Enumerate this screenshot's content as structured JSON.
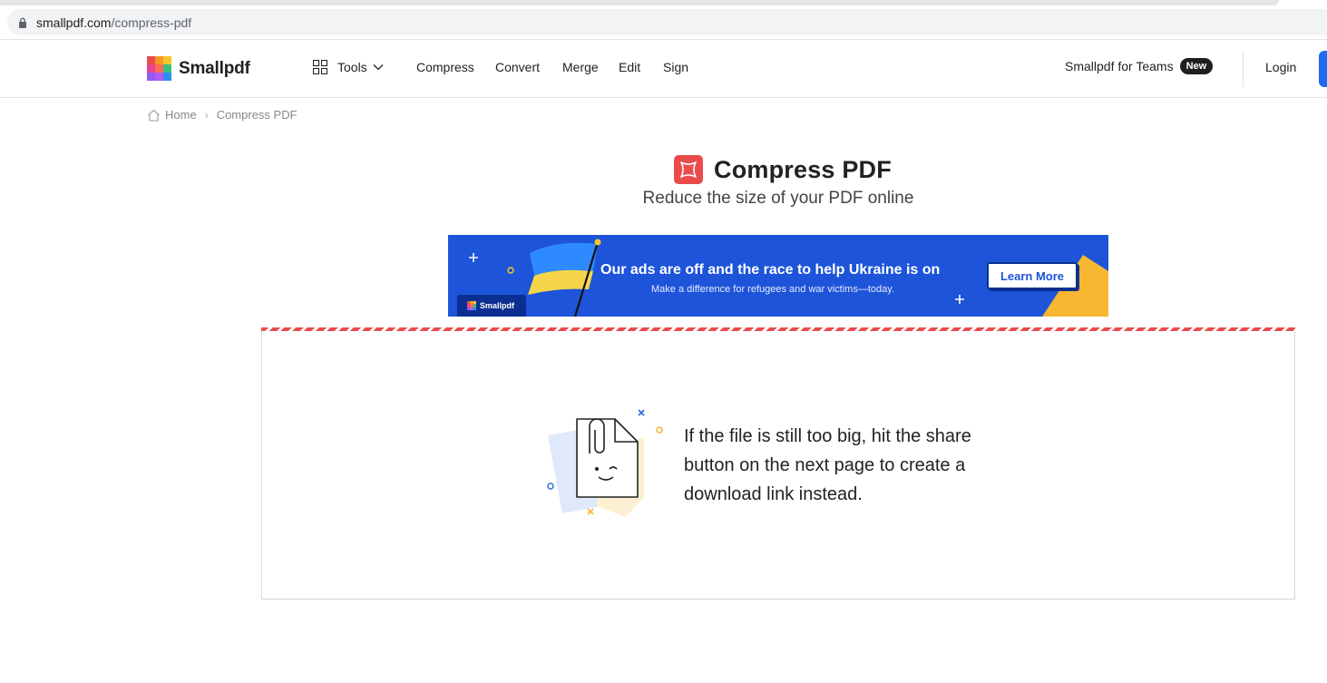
{
  "browser": {
    "url_host": "smallpdf.com",
    "url_path": "/compress-pdf"
  },
  "header": {
    "brand": "Smallpdf",
    "tools_label": "Tools",
    "nav": [
      "Compress",
      "Convert",
      "Merge",
      "Edit",
      "Sign"
    ],
    "teams_label": "Smallpdf for Teams",
    "teams_badge": "New",
    "login_label": "Login"
  },
  "breadcrumb": {
    "home": "Home",
    "current": "Compress PDF"
  },
  "page": {
    "title": "Compress PDF",
    "subtitle": "Reduce the size of your PDF online"
  },
  "banner": {
    "heading": "Our ads are off and the race to help Ukraine is on",
    "subtext": "Make a difference for refugees and war victims—today.",
    "button": "Learn More",
    "tag": "Smallpdf"
  },
  "tip": {
    "text": "If the file is still too big, hit the share button on the next page to create a download link instead."
  },
  "colors": {
    "accent_red": "#ea4c4c",
    "banner_blue": "#1d54d9",
    "cta_blue": "#1c6bf2"
  }
}
